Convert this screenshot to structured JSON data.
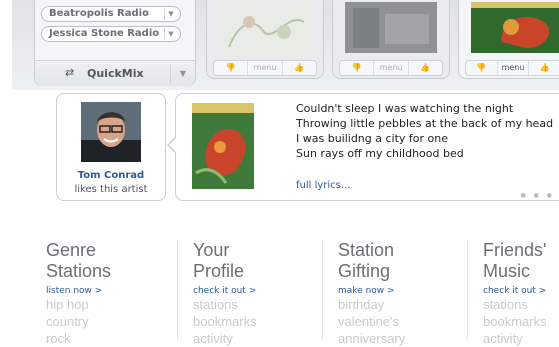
{
  "stations": {
    "items": [
      {
        "label": "Beatropolis Radio"
      },
      {
        "label": "Jessica Stone Radio"
      }
    ],
    "quickmix_label": "QuickMix"
  },
  "tracks": {
    "menu_label": "menu"
  },
  "fan": {
    "name": "Tom Conrad",
    "subtitle": "likes this artist"
  },
  "lyrics": {
    "lines": [
      "Couldn't sleep I was watching the night",
      "Throwing little pebbles at the back of my head",
      "I was builidng a city for one",
      "Sun rays off my childhood bed"
    ],
    "full_link": "full lyrics..."
  },
  "sections": [
    {
      "title1": "Genre",
      "title2": "Stations",
      "link": "listen now >",
      "items": [
        "hip hop",
        "country",
        "rock"
      ]
    },
    {
      "title1": "Your",
      "title2": "Profile",
      "link": "check it out >",
      "items": [
        "stations",
        "bookmarks",
        "activity"
      ]
    },
    {
      "title1": "Station",
      "title2": "Gifting",
      "link": "make now >",
      "items": [
        "birthday",
        "valentine's",
        "anniversary"
      ]
    },
    {
      "title1": "Friends'",
      "title2": "Music",
      "link": "check it out >",
      "items": [
        "stations",
        "bookmarks",
        "activity"
      ]
    }
  ],
  "colors": {
    "link": "#2d5a9a",
    "muted_text": "#c7ccd1",
    "heading": "#6b7075"
  }
}
